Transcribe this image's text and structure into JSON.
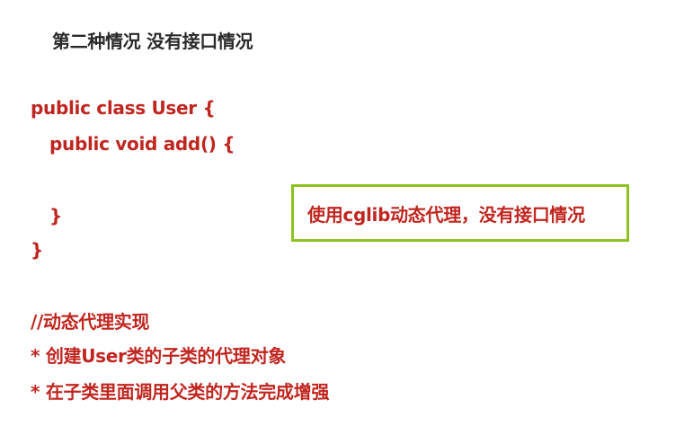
{
  "heading": "第二种情况 没有接口情况",
  "code": {
    "line1": "public class User {",
    "line2": "public void add() {",
    "line3": "}",
    "line4": "}"
  },
  "callout": {
    "text": "使用cglib动态代理，没有接口情况",
    "border_color": "#8dc21f"
  },
  "comments": {
    "line1": "//动态代理实现",
    "line2": "* 创建User类的子类的代理对象",
    "line3": "* 在子类里面调用父类的方法完成增强"
  },
  "colors": {
    "text_red": "#c0261f",
    "text_dark": "#2a2a2a",
    "background": "#ffffff"
  }
}
